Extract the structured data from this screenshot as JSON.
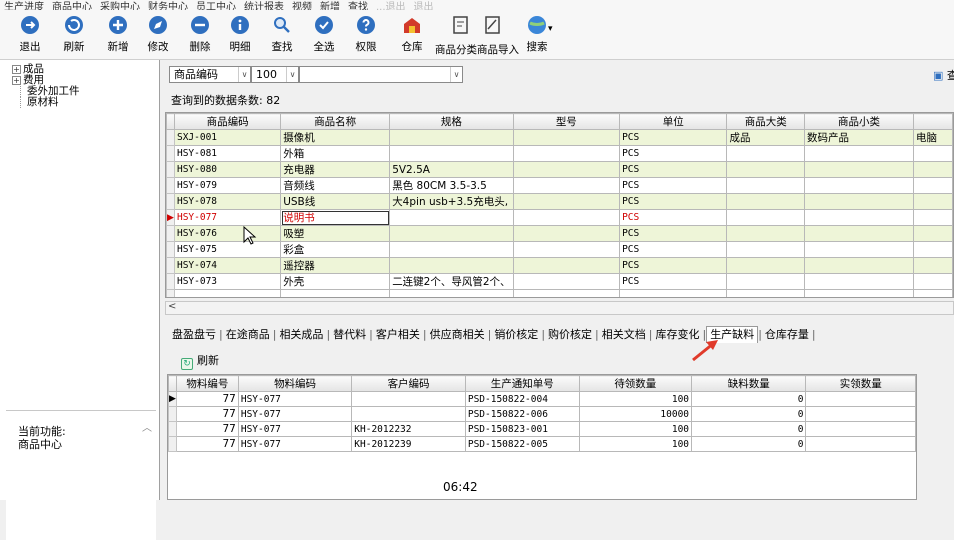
{
  "menu": [
    "生产进度",
    "商品中心",
    "采购中心",
    "财务中心",
    "员工中心",
    "统计报表",
    "视频",
    "新增",
    "查找",
    "...退出",
    "退出"
  ],
  "toolbar": {
    "exit": "退出",
    "refresh": "刷新",
    "add": "新增",
    "edit": "修改",
    "delete": "删除",
    "detail": "明细",
    "find": "查找",
    "selectall": "全选",
    "permission": "权限",
    "warehouse": "仓库",
    "import": "商品分类商品导入",
    "search": "搜索"
  },
  "tree": [
    {
      "expander": "+",
      "label": "成品"
    },
    {
      "expander": "+",
      "label": "费用"
    },
    {
      "expander": "",
      "label": "委外加工件"
    },
    {
      "expander": "",
      "label": "原材料"
    }
  ],
  "current_function": {
    "label": "当前功能:",
    "value": "商品中心"
  },
  "filter": {
    "field": "商品编码",
    "limit": "100",
    "value": "",
    "query_label": "查"
  },
  "record_count": "查询到的数据条数: 82",
  "grid": {
    "headers": [
      "商品编码",
      "商品名称",
      "规格",
      "型号",
      "单位",
      "商品大类",
      "商品小类",
      ""
    ],
    "rows": [
      [
        "SXJ-001",
        "摄像机",
        "",
        "",
        "PCS",
        "成品",
        "数码产品",
        "电脑"
      ],
      [
        "HSY-081",
        "外箱",
        "",
        "",
        "PCS",
        "",
        "",
        ""
      ],
      [
        "HSY-080",
        "充电器",
        "5V2.5A",
        "",
        "PCS",
        "",
        "",
        ""
      ],
      [
        "HSY-079",
        "音频线",
        "黑色 80CM 3.5-3.5",
        "",
        "PCS",
        "",
        "",
        ""
      ],
      [
        "HSY-078",
        "USB线",
        "大4pin usb+3.5充电头,",
        "",
        "PCS",
        "",
        "",
        ""
      ],
      [
        "HSY-077",
        "说明书",
        "",
        "",
        "PCS",
        "",
        "",
        ""
      ],
      [
        "HSY-076",
        "吸塑",
        "",
        "",
        "PCS",
        "",
        "",
        ""
      ],
      [
        "HSY-075",
        "彩盒",
        "",
        "",
        "PCS",
        "",
        "",
        ""
      ],
      [
        "HSY-074",
        "遥控器",
        "",
        "",
        "PCS",
        "",
        "",
        ""
      ],
      [
        "HSY-073",
        "外壳",
        "二连键2个、导风管2个、",
        "",
        "PCS",
        "",
        "",
        ""
      ]
    ],
    "selected_row": 5
  },
  "tabs": [
    "盘盈盘亏",
    "在途商品",
    "相关成品",
    "替代料",
    "客户相关",
    "供应商相关",
    "销价核定",
    "购价核定",
    "相关文档",
    "库存变化",
    "生产缺料",
    "仓库存量"
  ],
  "active_tab": 10,
  "sub_refresh": "刷新",
  "grid2": {
    "headers": [
      "物料编号",
      "物料编码",
      "客户编码",
      "生产通知单号",
      "待领数量",
      "缺料数量",
      "实领数量"
    ],
    "rows": [
      [
        "77",
        "HSY-077",
        "",
        "PSD-150822-004",
        "100",
        "0",
        ""
      ],
      [
        "77",
        "HSY-077",
        "",
        "PSD-150822-006",
        "10000",
        "0",
        ""
      ],
      [
        "77",
        "HSY-077",
        "KH-2012232",
        "PSD-150823-001",
        "100",
        "0",
        ""
      ],
      [
        "77",
        "HSY-077",
        "KH-2012239",
        "PSD-150822-005",
        "100",
        "0",
        ""
      ]
    ]
  },
  "clock": "06:42",
  "colors": {
    "row_alt": "#eef5d8",
    "selected_text": "#d00000",
    "arrow": "#e03a2a"
  }
}
